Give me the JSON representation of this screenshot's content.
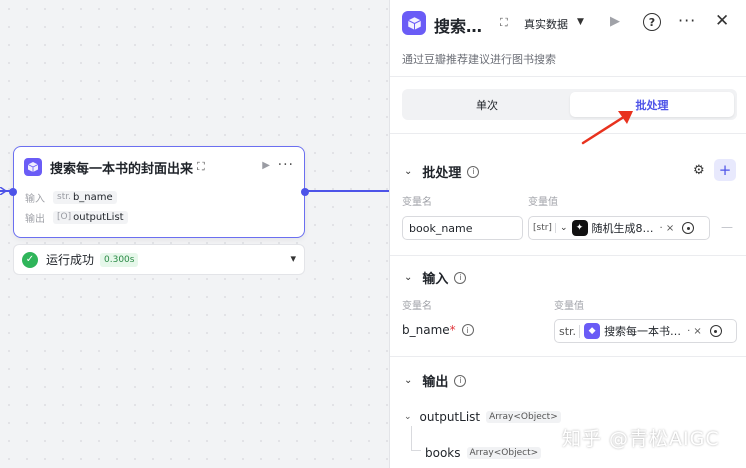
{
  "canvas": {
    "node": {
      "title": "搜索每一本书的封面出来",
      "input_label": "输入",
      "input_type": "str.",
      "input_value": "b_name",
      "output_label": "输出",
      "output_type": "[O]",
      "output_value": "outputList"
    },
    "status": {
      "text": "运行成功",
      "time": "0.300s"
    }
  },
  "panel": {
    "title": "搜索…",
    "mode": "真实数据",
    "description": "通过豆瓣推荐建议进行图书搜索",
    "tabs": [
      {
        "label": "单次",
        "active": false
      },
      {
        "label": "批处理",
        "active": true
      }
    ],
    "batch": {
      "title": "批处理",
      "var_name_header": "变量名",
      "var_value_header": "变量值",
      "var_name_value": "book_name",
      "var_type": "[str]",
      "var_ref": "随机生成8…"
    },
    "input": {
      "title": "输入",
      "var_name_header": "变量名",
      "var_value_header": "变量值",
      "param_name": "b_name",
      "required_mark": "*",
      "type": "str.",
      "ref": "搜索每一本书…"
    },
    "output": {
      "title": "输出",
      "items": [
        {
          "name": "outputList",
          "type": "Array<Object>"
        },
        {
          "name": "books",
          "type": "Array<Object>"
        }
      ]
    }
  },
  "watermark": "知乎 @青松AIGC",
  "colors": {
    "accent": "#4d53e8",
    "node_icon": "#6a5cf6",
    "success": "#2fb55a",
    "annotation_arrow": "#e8321e"
  }
}
